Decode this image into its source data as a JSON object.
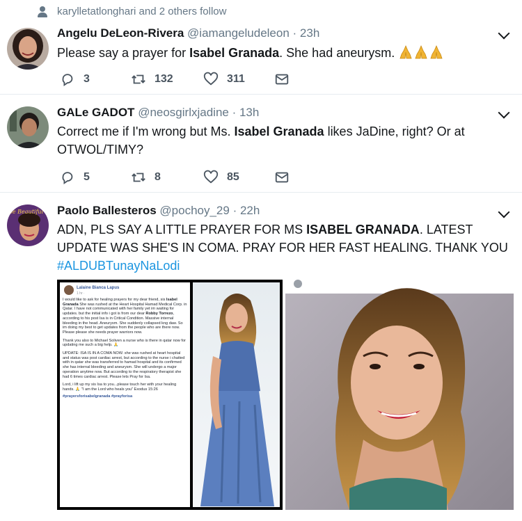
{
  "social_context": {
    "text": "karylletatlonghari and 2 others follow"
  },
  "tweets": [
    {
      "name": "Angelu DeLeon-Rivera",
      "handle": "@iamangeludeleon",
      "time": "· 23h",
      "text_before": "Please say a prayer for ",
      "text_bold": "Isabel Granada",
      "text_after": ". She had aneurysm.",
      "reply_count": "3",
      "retweet_count": "132",
      "like_count": "311"
    },
    {
      "name": "GALe GADOT",
      "handle": "@neosgirlxjadine",
      "time": "· 13h",
      "text_before": "Correct me if I'm wrong but Ms. ",
      "text_bold": "Isabel Granada",
      "text_after": " likes JaDine, right? Or at OTWOL/TIMY?",
      "reply_count": "5",
      "retweet_count": "8",
      "like_count": "85"
    },
    {
      "name": "Paolo Ballesteros",
      "handle": "@pochoy_29",
      "time": "· 22h",
      "text_before": "ADN, PLS SAY A LITTLE PRAYER FOR MS ",
      "text_bold": "ISABEL GRANADA",
      "text_after": ". LATEST UPDATE WAS SHE'S IN COMA. PRAY FOR HER FAST HEALING. THANK YOU",
      "hashtag": "#ALDUBTunayNaLodi",
      "avatar_caption": "Be Beautiful"
    }
  ],
  "post_card": {
    "author": "Lalaine Bianca Lapus",
    "meta": "1 hr · ",
    "p1_a": "I would like to ask for healing prayers for my dear friend, sis ",
    "p1_bold": "Isabel Granada",
    "p1_b": " She was rushed at the Heart Hospital Hamad Medical Corp. in Qatar. I have not communicated with her family yet im waiting for updates. but the initial info i got is from our dear ",
    "p1_bold2": "Robby Torrezo",
    "p1_c": ", according to his post Isa is in Critical Condition. Massive internal bleeding in the head. Aneurysm. She suddenly collapsed kng daw. So im doing my best to get updates from the people who are there now. Please please she needs prayer warriors now.",
    "p2": "Thank you also to Michael Soliven a nurse who is there in qatar now for updating me such a big help. 🙏",
    "p3": "UPDATE: ISA IS IN A COMA NOW. she was rushed at heart hospital and status was post cardiac arrest, but according to the nurse i chatted with in qatar she was transferred to hamad hospital and its confirmed she has internal bleeding and aneurysm. She will undergo a major operation anytime now. But according to the respiratory therapist she had 6 times cardiac arrest. Please lets Pray for Isa.",
    "p4": "Lord, i lift up my sis Isa to you...please touch her with your healing hands. 🙏 \"I am the Lord who heals you\" Exodus 15:26",
    "tags": "#prayersforisabelgranada #prayforisa"
  },
  "colors": {
    "link": "#1b95e0",
    "secondary_text": "#657786",
    "divider": "#e6ecf0"
  },
  "icons": [
    "person-icon",
    "chevron-down-icon",
    "reply-icon",
    "retweet-icon",
    "like-icon",
    "message-icon",
    "folded-hands-icon"
  ]
}
